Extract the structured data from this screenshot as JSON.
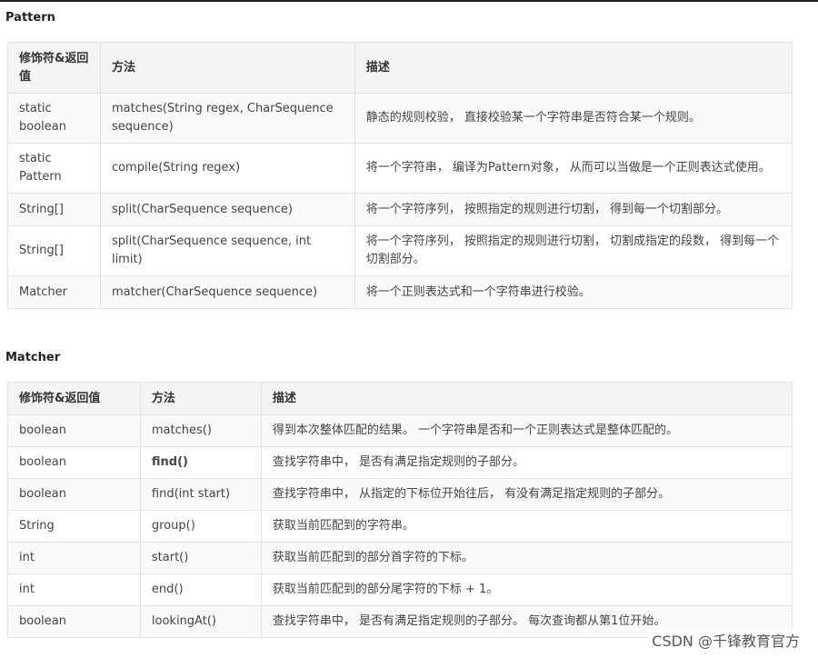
{
  "pattern": {
    "title": "Pattern",
    "headers": [
      "修饰符&返回值",
      "方法",
      "描述"
    ],
    "rows": [
      [
        "static boolean",
        "matches(String regex, CharSequence sequence)",
        "静态的规则校验， 直接校验某一个字符串是否符合某一个规则。"
      ],
      [
        "static Pattern",
        "compile(String regex)",
        "将一个字符串， 编译为Pattern对象， 从而可以当做是一个正则表达式使用。"
      ],
      [
        "String[]",
        "split(CharSequence sequence)",
        "将一个字符序列， 按照指定的规则进行切割， 得到每一个切割部分。"
      ],
      [
        "String[]",
        "split(CharSequence sequence, int limit)",
        "将一个字符序列， 按照指定的规则进行切割， 切割成指定的段数， 得到每一个切割部分。"
      ],
      [
        "Matcher",
        "matcher(CharSequence sequence)",
        "将一个正则表达式和一个字符串进行校验。"
      ]
    ]
  },
  "matcher": {
    "title": "Matcher",
    "headers": [
      "修饰符&返回值",
      "方法",
      "描述"
    ],
    "rows": [
      [
        "boolean",
        "matches()",
        "得到本次整体匹配的结果。 一个字符串是否和一个正则表达式是整体匹配的。"
      ],
      [
        "boolean",
        "find()",
        "查找字符串中， 是否有满足指定规则的子部分。"
      ],
      [
        "boolean",
        "find(int start)",
        "查找字符串中， 从指定的下标位开始往后， 有没有满足指定规则的子部分。"
      ],
      [
        "String",
        "group()",
        "获取当前匹配到的字符串。"
      ],
      [
        "int",
        "start()",
        "获取当前匹配到的部分首字符的下标。"
      ],
      [
        "int",
        "end()",
        "获取当前匹配到的部分尾字符的下标 + 1。"
      ],
      [
        "boolean",
        "lookingAt()",
        "查找字符串中， 是否有满足指定规则的子部分。 每次查询都从第1位开始。"
      ]
    ]
  },
  "watermark": "CSDN @千锋教育官方"
}
